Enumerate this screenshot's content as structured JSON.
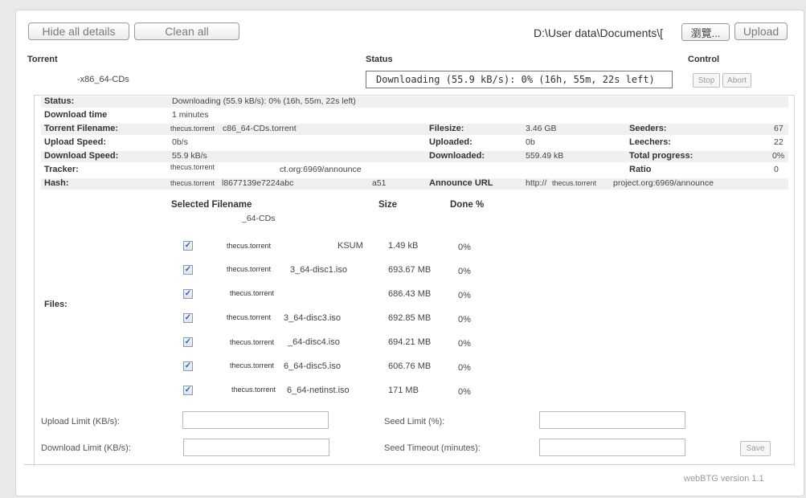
{
  "toolbar": {
    "hide_details": "Hide all details",
    "clean_all": "Clean all",
    "path_value": "D:\\User data\\Documents\\[",
    "browse": "瀏覽...",
    "upload": "Upload"
  },
  "header": {
    "torrent": "Torrent",
    "status": "Status",
    "control": "Control"
  },
  "torrent_row": {
    "name": "-x86_64-CDs",
    "status": "Downloading (55.9 kB/s): 0% (16h, 55m, 22s left)",
    "stop": "Stop",
    "abort": "Abort"
  },
  "details": {
    "status_label": "Status:",
    "status_value": "Downloading (55.9 kB/s): 0% (16h, 55m, 22s left)",
    "dltime_label": "Download time",
    "dltime_value": "1 minutes",
    "tfile_label": "Torrent Filename:",
    "tfile_prefix": "thecus.torrent",
    "tfile_value": "c86_64-CDs.torrent",
    "filesize_label": "Filesize:",
    "filesize_value": "3.46 GB",
    "seeders_label": "Seeders:",
    "seeders_value": "67",
    "upspeed_label": "Upload Speed:",
    "upspeed_value": "0b/s",
    "uploaded_label": "Uploaded:",
    "uploaded_value": "0b",
    "leechers_label": "Leechers:",
    "leechers_value": "22",
    "dlspeed_label": "Download Speed:",
    "dlspeed_value": "55.9 kB/s",
    "downloaded_label": "Downloaded:",
    "downloaded_value": "559.49 kB",
    "progress_label": "Total progress:",
    "progress_value": "0%",
    "tracker_label": "Tracker:",
    "tracker_prefix": "thecus.torrent",
    "tracker_value": "ct.org:6969/announce",
    "ratio_label": "Ratio",
    "ratio_value": "0",
    "hash_label": "Hash:",
    "hash_prefix": "thecus.torrent",
    "hash_value": "l8677139e7224abc",
    "hash_suffix": "a51",
    "announce_label": "Announce URL",
    "announce_prefix": "http://",
    "announce_mid": "thecus.torrent",
    "announce_value": "project.org:6969/announce"
  },
  "files": {
    "label": "Files:",
    "col_filename": "Selected Filename",
    "col_size": "Size",
    "col_done": "Done %",
    "folder": "_64-CDs",
    "items": [
      {
        "prefix": "thecus.torrent",
        "name": "KSUM",
        "size": "1.49 kB",
        "done": "0%"
      },
      {
        "prefix": "thecus.torrent",
        "name": "3_64-disc1.iso",
        "size": "693.67 MB",
        "done": "0%"
      },
      {
        "prefix": "thecus.torrent",
        "name": "",
        "size": "686.43 MB",
        "done": "0%"
      },
      {
        "prefix": "thecus.torrent",
        "name": "3_64-disc3.iso",
        "size": "692.85 MB",
        "done": "0%"
      },
      {
        "prefix": "thecus.torrent",
        "name": "_64-disc4.iso",
        "size": "694.21 MB",
        "done": "0%"
      },
      {
        "prefix": "thecus.torrent",
        "name": "6_64-disc5.iso",
        "size": "606.76 MB",
        "done": "0%"
      },
      {
        "prefix": "thecus.torrent",
        "name": "6_64-netinst.iso",
        "size": "171 MB",
        "done": "0%"
      }
    ]
  },
  "limits": {
    "upload_label": "Upload Limit (KB/s):",
    "download_label": "Download Limit (KB/s):",
    "seed_limit_label": "Seed Limit (%):",
    "seed_timeout_label": "Seed Timeout (minutes):",
    "save": "Save"
  },
  "footer": {
    "version": "webBTG version 1.1"
  }
}
